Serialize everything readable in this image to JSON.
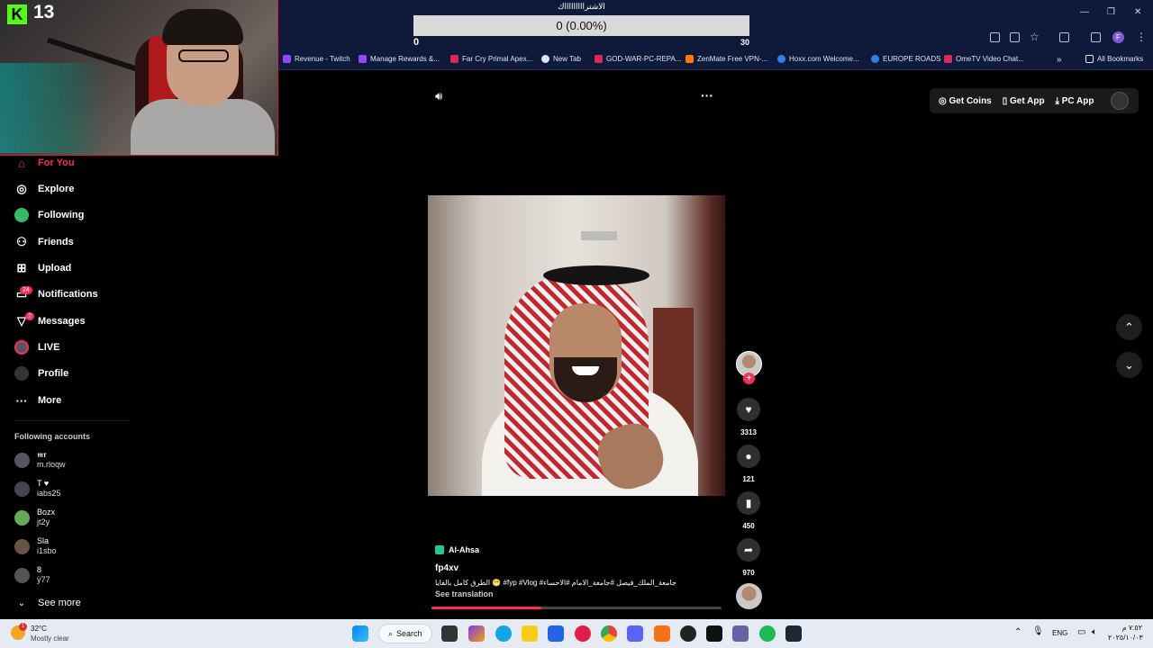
{
  "browser": {
    "bookmarks": [
      {
        "label": "Revenue - Twitch",
        "color": "#9146ff"
      },
      {
        "label": "Manage Rewards &...",
        "color": "#9146ff"
      },
      {
        "label": "Far Cry Primal Apex...",
        "color": "#e0245e"
      },
      {
        "label": "New Tab",
        "color": "#dfe5f5"
      },
      {
        "label": "GOD-WAR-PC-REPA...",
        "color": "#e0245e"
      },
      {
        "label": "ZenMate Free VPN-...",
        "color": "#ff7a00"
      },
      {
        "label": "Hoxx.com Welcome...",
        "color": "#2f80ed"
      },
      {
        "label": "EUROPE ROADS",
        "color": "#2f80ed"
      },
      {
        "label": "OmeTV Video Chat...",
        "color": "#e0245e"
      }
    ],
    "more_bookmarks": "»",
    "all_bookmarks": "All Bookmarks",
    "profile_initial": "F",
    "window_controls": {
      "minimize": "—",
      "restore": "❐",
      "close": "✕"
    }
  },
  "overlay": {
    "poll_title": "الاشتراااااااااك",
    "progress_text": "0 (0.00%)",
    "progress_value": 0,
    "min": "0",
    "max": "30",
    "stream_logo": "K",
    "stream_count": "13"
  },
  "sidebar": {
    "items": [
      {
        "label": "For You",
        "icon": "home-icon",
        "glyph": "⌂",
        "active": true
      },
      {
        "label": "Explore",
        "icon": "compass-icon",
        "glyph": "◎"
      },
      {
        "label": "Following",
        "icon": "following-avatar-icon",
        "glyph": "●"
      },
      {
        "label": "Friends",
        "icon": "friends-icon",
        "glyph": "👥"
      },
      {
        "label": "Upload",
        "icon": "upload-icon",
        "glyph": "⊞"
      },
      {
        "label": "Notifications",
        "icon": "bell-icon",
        "glyph": "☐",
        "badge": "24"
      },
      {
        "label": "Messages",
        "icon": "send-icon",
        "glyph": "▽",
        "badge": "2"
      },
      {
        "label": "LIVE",
        "icon": "live-icon",
        "glyph": "◉"
      },
      {
        "label": "Profile",
        "icon": "profile-icon",
        "glyph": "●"
      },
      {
        "label": "More",
        "icon": "more-icon",
        "glyph": "···"
      }
    ],
    "following_heading": "Following accounts",
    "accounts": [
      {
        "name": "𝖒𝖗",
        "handle": "m.rloqw"
      },
      {
        "name": "T ♥",
        "handle": "iabs25"
      },
      {
        "name": "Bozx",
        "handle": "jt2y"
      },
      {
        "name": "Sla",
        "handle": "i1sbo"
      },
      {
        "name": "8",
        "handle": "ÿ77"
      }
    ],
    "see_more": "See more"
  },
  "top_actions": {
    "get_coins": "Get Coins",
    "get_app": "Get App",
    "pc_app": "PC App"
  },
  "video": {
    "location": "Al-Ahsa",
    "author": "fp4xv",
    "caption": "الطرق كامل بالفايا 😁 #fyp #Vlog #جامعة_الملك_فيصل #جامعة_الامام #الاحساء",
    "see_translation": "See translation",
    "likes": "3313",
    "comments": "121",
    "saves": "450",
    "shares": "970",
    "progress": 0.38
  },
  "taskbar": {
    "weather_temp": "32°C",
    "weather_desc": "Mostly clear",
    "weather_badge": "1",
    "search_label": "Search",
    "language": "ENG",
    "time": "٧:٥٢ م",
    "date": "٢٠٢٥/١٠/٠٣"
  }
}
